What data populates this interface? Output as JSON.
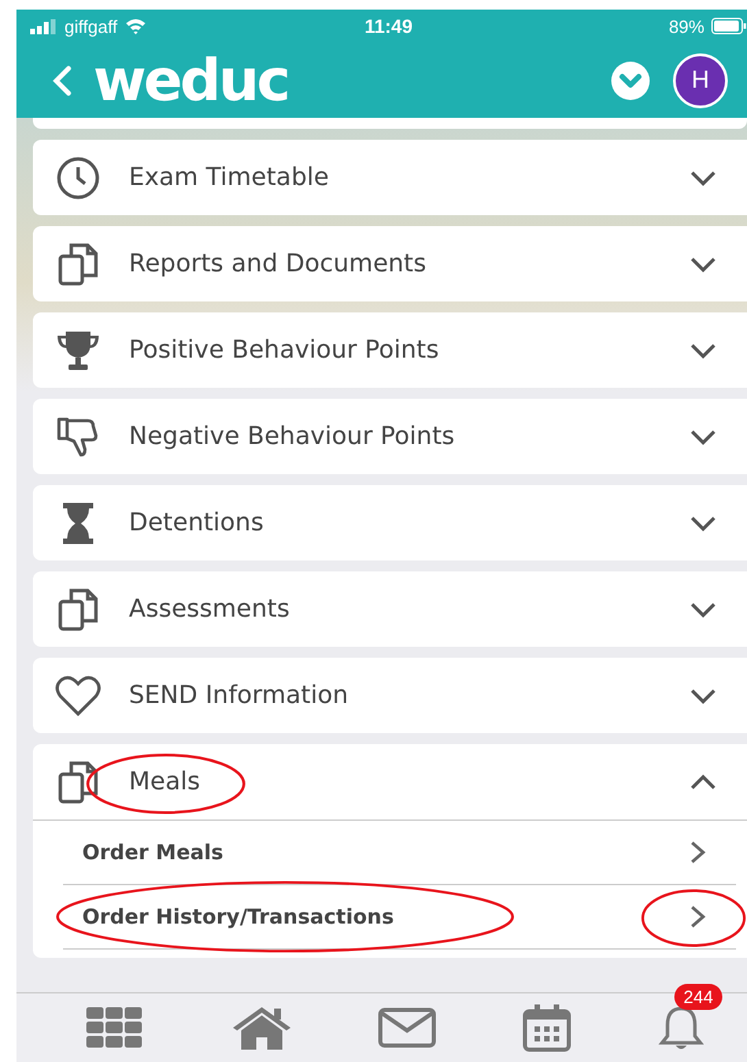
{
  "status_bar": {
    "carrier": "giffgaff",
    "time": "11:49",
    "battery": "89%"
  },
  "header": {
    "logo": "weduc",
    "avatar": "H"
  },
  "sections": [
    {
      "kind": "clock",
      "label": "Exam Timetable",
      "expanded": false,
      "circled": false
    },
    {
      "kind": "documents",
      "label": "Reports and Documents",
      "expanded": false,
      "circled": false
    },
    {
      "kind": "trophy",
      "label": "Positive Behaviour Points",
      "expanded": false,
      "circled": false
    },
    {
      "kind": "thumbs-down",
      "label": "Negative Behaviour Points",
      "expanded": false,
      "circled": false
    },
    {
      "kind": "hourglass",
      "label": "Detentions",
      "expanded": false,
      "circled": false
    },
    {
      "kind": "documents",
      "label": "Assessments",
      "expanded": false,
      "circled": false
    },
    {
      "kind": "heart",
      "label": "SEND Information",
      "expanded": false,
      "circled": false
    },
    {
      "kind": "documents",
      "label": "Meals",
      "expanded": true,
      "circled": true,
      "children": [
        {
          "label": "Order Meals",
          "circled": false,
          "chevron_circled": false
        },
        {
          "label": "Order History/Transactions",
          "circled": true,
          "chevron_circled": true
        }
      ]
    }
  ],
  "tab_bar": [
    {
      "kind": "grid"
    },
    {
      "kind": "home"
    },
    {
      "kind": "mail"
    },
    {
      "kind": "calendar"
    },
    {
      "kind": "bell",
      "badge": "244"
    }
  ]
}
